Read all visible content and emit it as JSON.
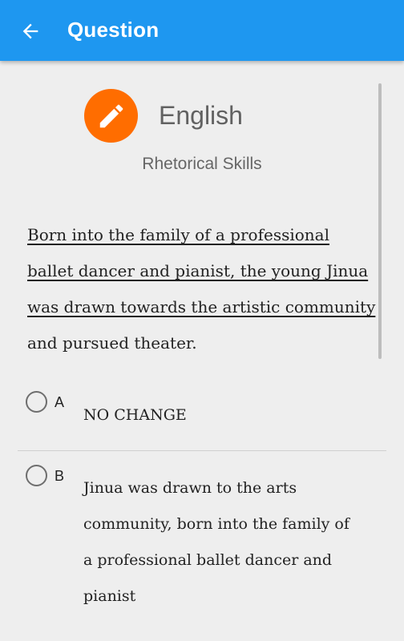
{
  "appbar": {
    "title": "Question",
    "back_icon": "arrow-back-icon",
    "color": "#1e97f0"
  },
  "subject": {
    "icon": "pencil-icon",
    "icon_color": "#ff6d00",
    "title": "English",
    "subtitle": "Rhetorical Skills"
  },
  "question": {
    "passage_underlined": "Born into the family of a professional ballet dancer and pianist, the young Jinua was drawn towards the artistic community",
    "passage_rest": " and pursued theater."
  },
  "options": [
    {
      "letter": "A",
      "text": "NO CHANGE",
      "selected": false
    },
    {
      "letter": "B",
      "text": "Jinua was drawn to the arts community, born into the family of a professional ballet dancer and pianist",
      "selected": false
    }
  ]
}
